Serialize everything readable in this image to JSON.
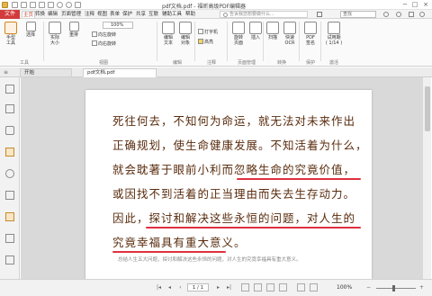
{
  "window": {
    "title": "pdf文档.pdf - 福昕高级PDF编辑器"
  },
  "menu": {
    "file": "文件",
    "items": [
      "主页",
      "转换",
      "编辑",
      "页面管理",
      "注释",
      "视图",
      "表单",
      "保护",
      "共享",
      "互联",
      "辅助工具",
      "帮助"
    ],
    "tellme_placeholder": "告诉我您想要做什么...",
    "search_placeholder": "查找"
  },
  "ribbon": {
    "hand_tool": "手型\n工具",
    "select_tool": "选择",
    "snapshot": "实际\n大小",
    "reflow": "重排",
    "zoom_value": "100%",
    "rotate_left": "向左旋转",
    "rotate_right": "向右旋转",
    "edit_text": "编辑\n文本",
    "edit_object": "编辑\n对象",
    "typewriter": "打字机",
    "highlight": "高亮",
    "rotate_page": "旋转\n页面",
    "insert": "插入",
    "scan": "扫描",
    "quick_ocr": "快速\nOCR",
    "pdf_sign": "PDF\n签名",
    "trial": "试用期\n( 1/14 )",
    "groups": [
      "工具",
      "视图",
      "编辑",
      "注释",
      "页面管理",
      "转换",
      "保护",
      "激活"
    ]
  },
  "tabs": {
    "start": "开始",
    "doc": "pdf文档.pdf"
  },
  "document": {
    "lines": [
      "死往何去，不知何为命运，就无法对未来作出",
      "正确规划，使生命健康发展。不知活着为什么，",
      "就会耽著于眼前小利而忽略生命的究竟价值，",
      "或因找不到活着的正当理由而失去生存动力。",
      "因此，探讨和解决这些永恒的问题，对人生的",
      "究竟幸福具有重大意义。"
    ],
    "caption": "总结人生五大问题，探讨和解决这些永恒的问题，对人生的究竟幸福具有重大意义。"
  },
  "status": {
    "page": "1 / 1",
    "zoom": "100%"
  },
  "colors": {
    "accent": "#d23b3b",
    "text": "#5a2c0e",
    "underline": "#e0303e"
  }
}
